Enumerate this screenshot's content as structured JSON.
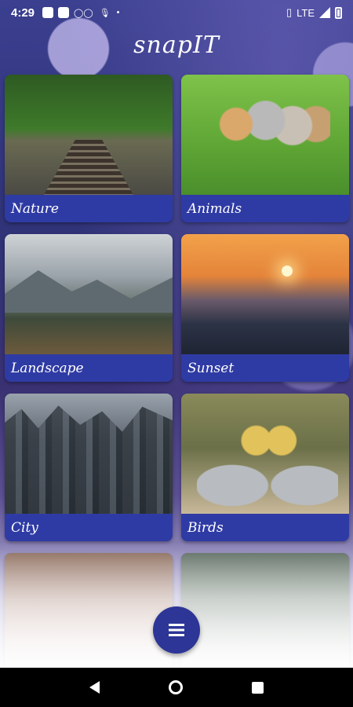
{
  "status_bar": {
    "time": "4:29",
    "network": "LTE",
    "icons": [
      "notification-icon",
      "notification-icon",
      "voicemail-icon",
      "mic-icon",
      "dot-icon",
      "vibrate-icon",
      "signal-icon",
      "battery-icon"
    ]
  },
  "app": {
    "title": "snapIT"
  },
  "categories": [
    {
      "label": "Nature",
      "image": "railway-forest"
    },
    {
      "label": "Animals",
      "image": "kittens-grass"
    },
    {
      "label": "Landscape",
      "image": "mountain-lake"
    },
    {
      "label": "Sunset",
      "image": "sea-sunset"
    },
    {
      "label": "City",
      "image": "city-skyline"
    },
    {
      "label": "Birds",
      "image": "crowned-cranes"
    },
    {
      "label": "",
      "image": "love-letters"
    },
    {
      "label": "",
      "image": "misty-forest"
    }
  ],
  "fab": {
    "icon": "menu-icon"
  },
  "nav_bar": {
    "icons": [
      "back-icon",
      "home-icon",
      "recents-icon"
    ]
  },
  "colors": {
    "accent": "#2f3ba4",
    "fab": "#2d3597",
    "header_bg": "#3b3f8f"
  }
}
